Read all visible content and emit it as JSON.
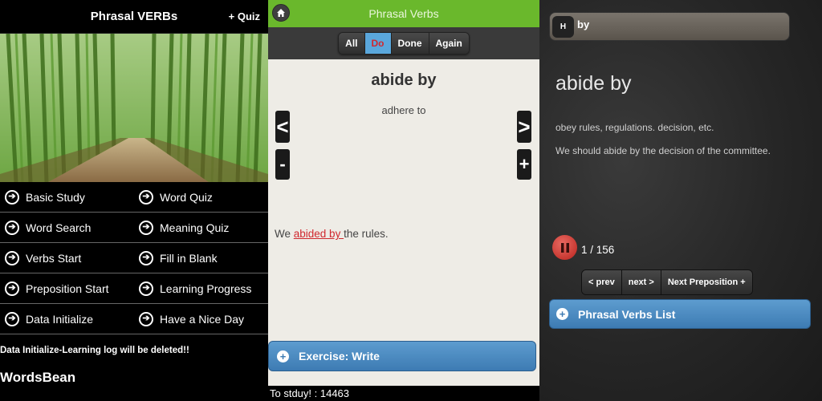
{
  "panel1": {
    "title": "Phrasal VERBs",
    "quiz_button": "+ Quiz",
    "hero_image": "bamboo-forest-path",
    "menu": [
      {
        "label": "Basic Study",
        "icon": "arrow-right-circle-icon"
      },
      {
        "label": "Word Quiz",
        "icon": "arrow-right-circle-icon"
      },
      {
        "label": "Word Search",
        "icon": "arrow-right-circle-icon"
      },
      {
        "label": "Meaning Quiz",
        "icon": "arrow-right-circle-icon"
      },
      {
        "label": "Verbs Start",
        "icon": "arrow-right-circle-icon"
      },
      {
        "label": "Fill in Blank",
        "icon": "arrow-right-circle-icon"
      },
      {
        "label": "Preposition Start",
        "icon": "arrow-right-circle-icon"
      },
      {
        "label": "Learning Progress",
        "icon": "arrow-right-circle-icon"
      },
      {
        "label": "Data Initialize",
        "icon": "arrow-right-circle-icon"
      },
      {
        "label": "Have a Nice Day",
        "icon": "arrow-right-circle-icon"
      }
    ],
    "warning": "Data Initialize-Learning log will be deleted!!",
    "brand": "WordsBean"
  },
  "panel2": {
    "title": "Phrasal Verbs",
    "header_color": "#6ab82c",
    "filters": [
      "All",
      "Do",
      "Done",
      "Again"
    ],
    "active_filter": "Do",
    "word": "abide by",
    "meaning": "adhere to",
    "prev_glyph": "<",
    "next_glyph": ">",
    "minus_glyph": "-",
    "plus_glyph": "+",
    "example_before": "We ",
    "example_highlight": "abided by ",
    "example_after": "the rules.",
    "exercise_button": "Exercise: Write",
    "footer": "To stduy! : 14463"
  },
  "panel3": {
    "header_badge": "H",
    "header_text": "by",
    "word": "abide by",
    "definition": "obey rules, regulations. decision, etc.",
    "example": "We should abide by the decision of the committee.",
    "counter": "1 / 156",
    "nav": [
      "< prev",
      "next >",
      "Next Preposition +"
    ],
    "list_button": "Phrasal Verbs List",
    "accent_color": "#3d7bb3"
  }
}
